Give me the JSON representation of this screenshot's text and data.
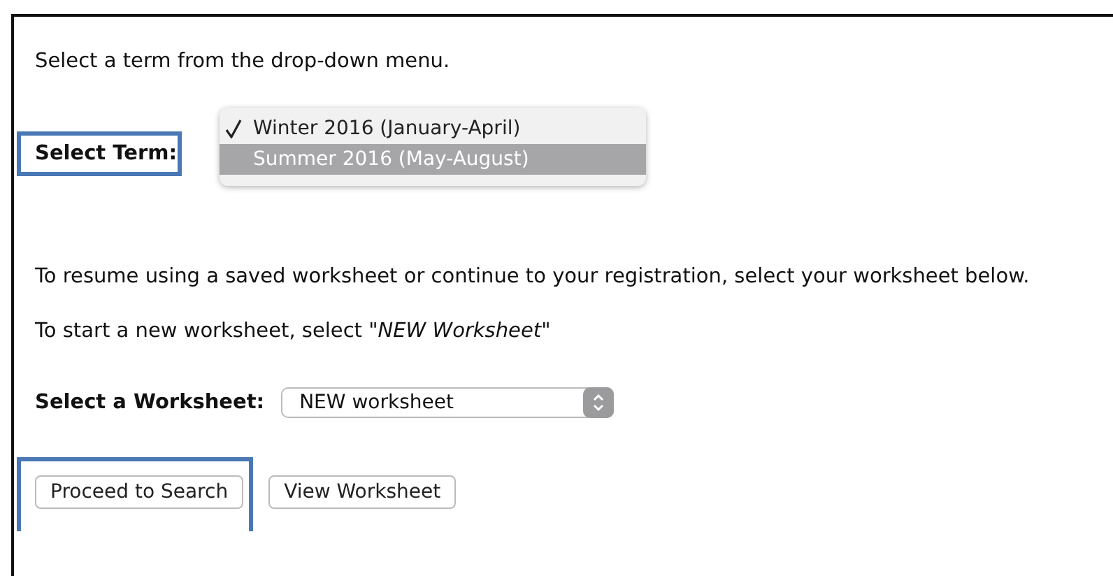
{
  "intro": "Select a term from the drop-down menu.",
  "term": {
    "label": "Select Term:",
    "highlighted": true,
    "options": [
      {
        "label": "Winter 2016 (January-April)",
        "checked": true,
        "selected": false
      },
      {
        "label": "Summer 2016 (May-August)",
        "checked": false,
        "selected": true
      }
    ]
  },
  "resume_text": "To resume using a saved worksheet or continue to your registration, select your worksheet below.",
  "new_text": "To start a new worksheet, select *\"NEW Worksheet\"*",
  "worksheet": {
    "label": "Select a Worksheet:",
    "value": "NEW worksheet"
  },
  "buttons": [
    {
      "label": "Proceed to Search",
      "highlighted": true
    },
    {
      "label": "View Worksheet",
      "highlighted": false
    }
  ]
}
